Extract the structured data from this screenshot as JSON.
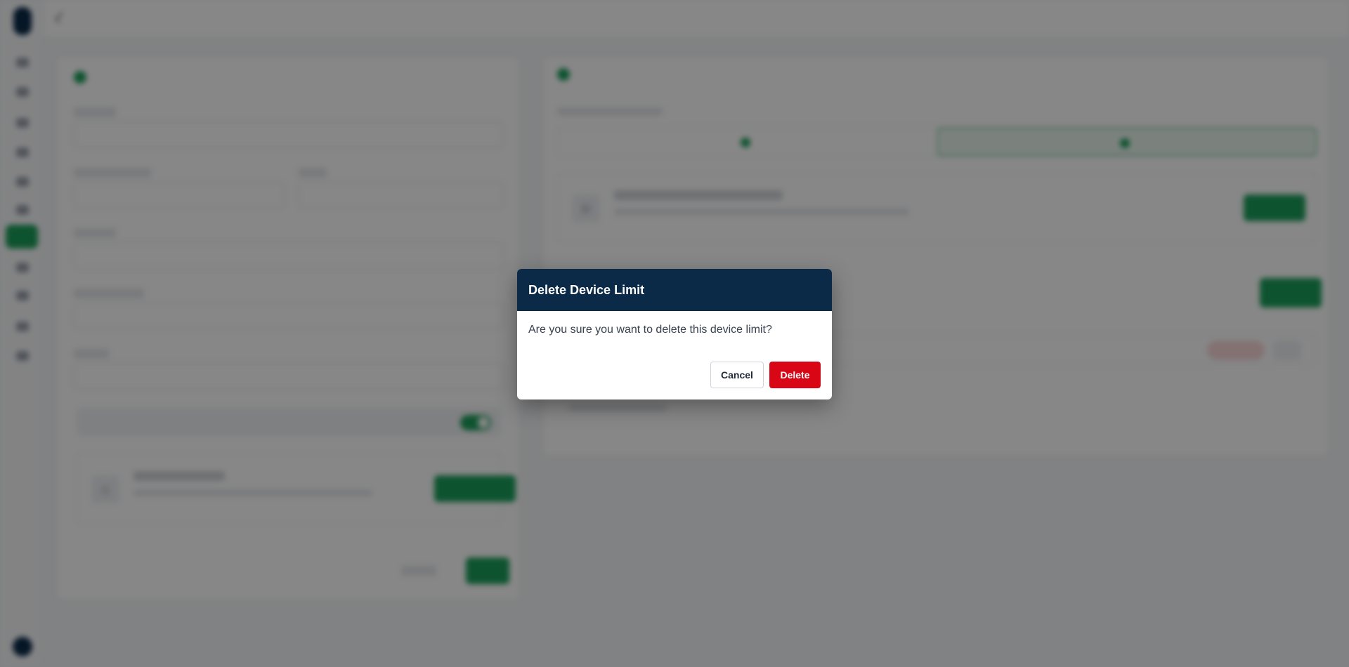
{
  "background": {
    "page_title": "",
    "left_card_title": "",
    "right_card_title": ""
  },
  "dialog": {
    "title": "Delete Device Limit",
    "message": "Are you sure you want to delete this device limit?",
    "cancel_label": "Cancel",
    "delete_label": "Delete"
  },
  "colors": {
    "header_bg": "#0b2a48",
    "delete_bg": "#d90616",
    "accent_green": "#1c9e5c"
  }
}
